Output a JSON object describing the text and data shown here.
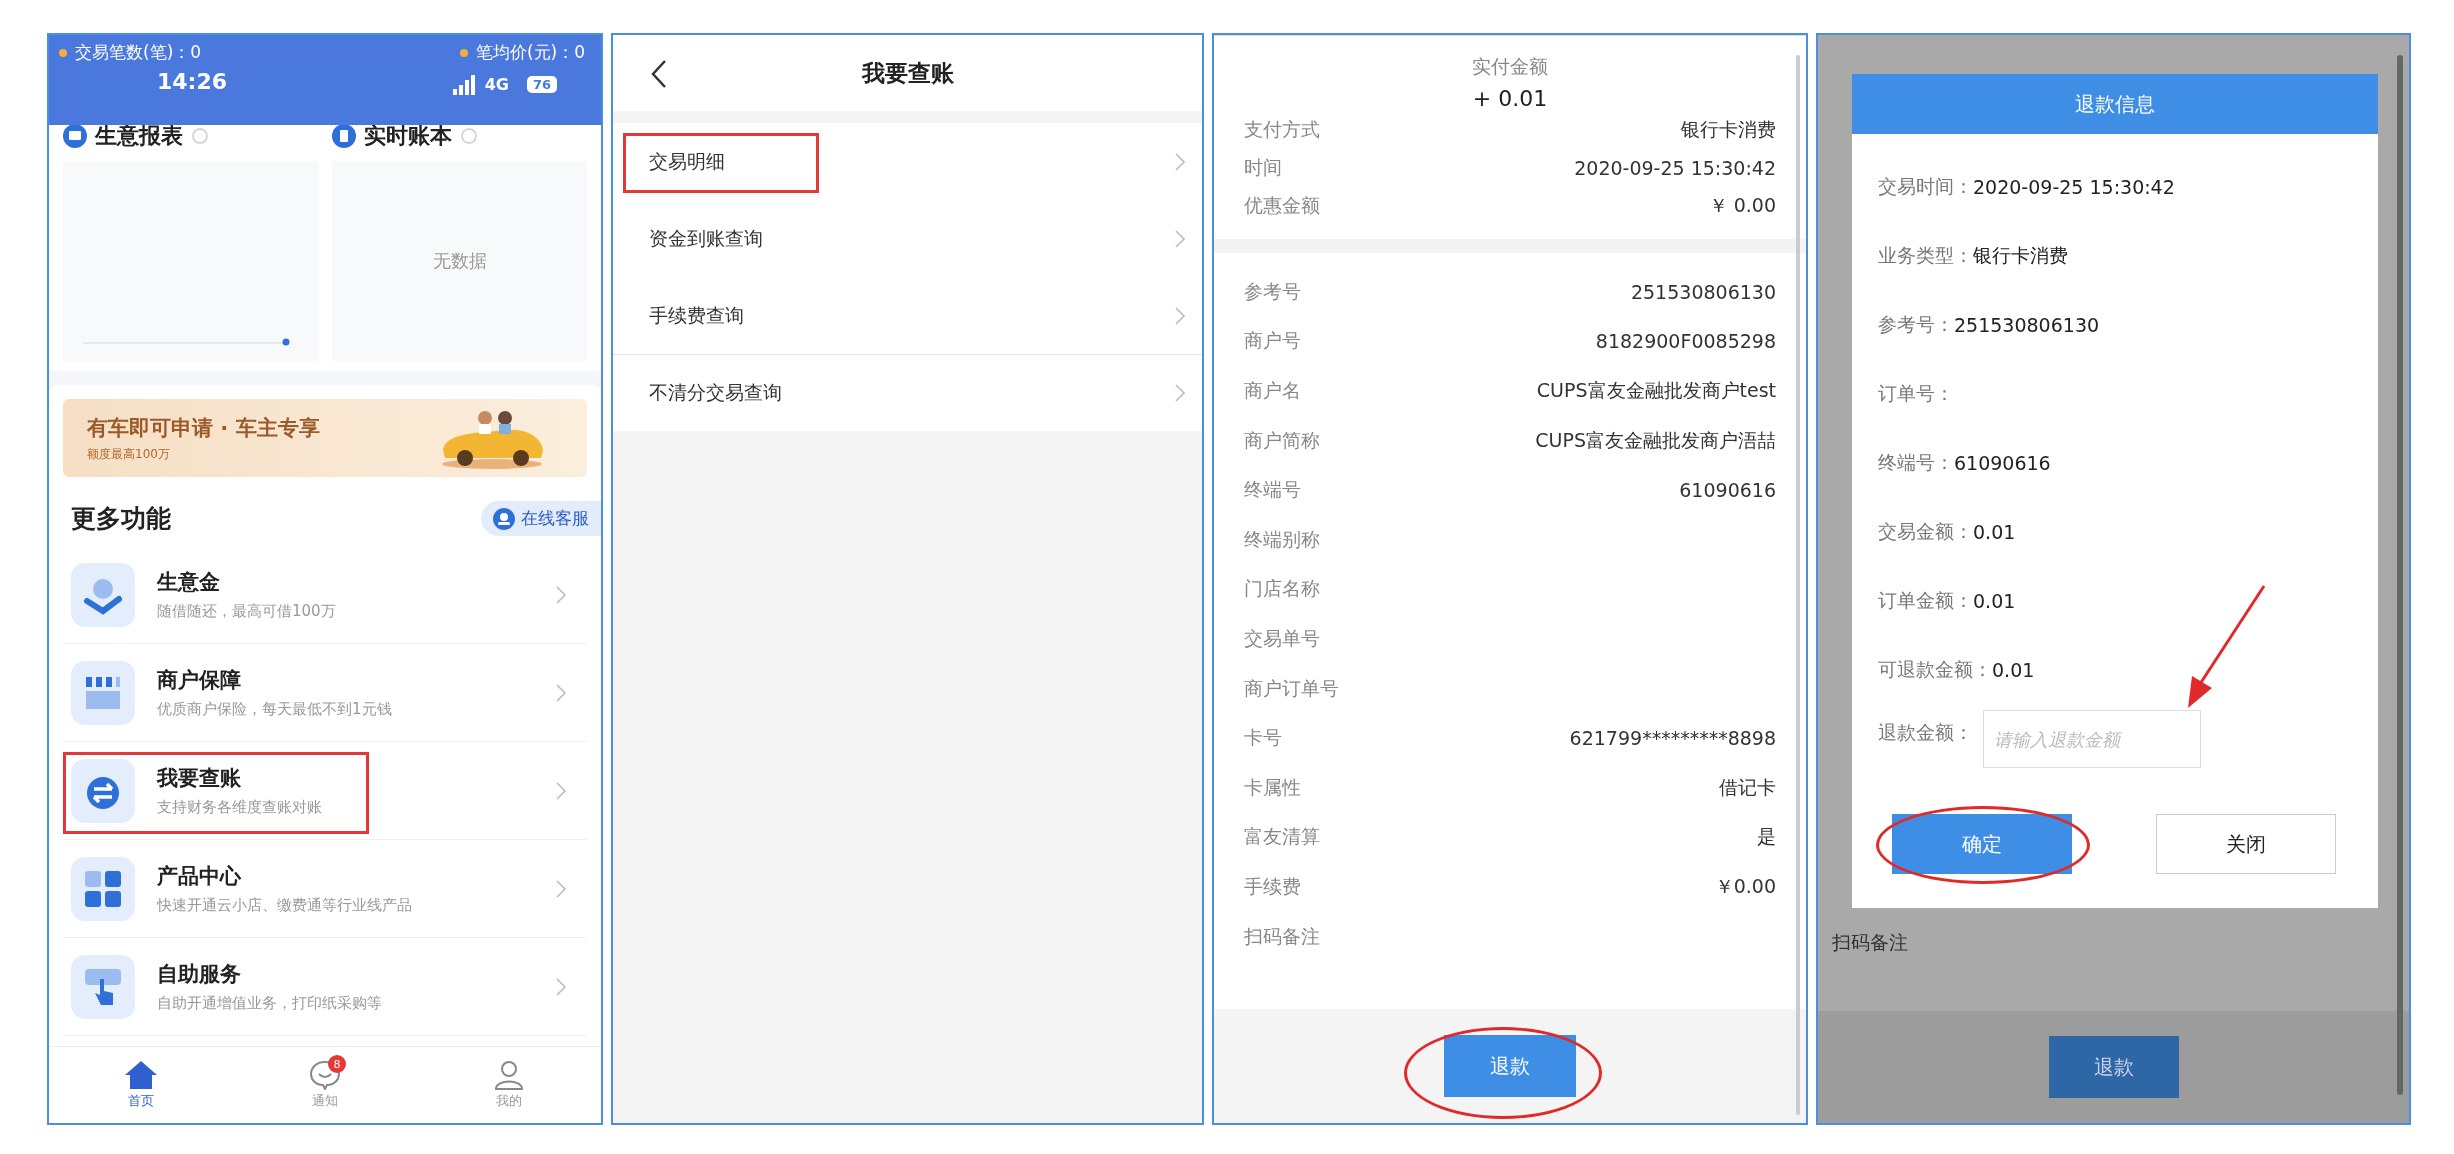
{
  "home": {
    "status_bar": {
      "stat_left": "交易笔数(笔)：0",
      "time": "14:26",
      "stat_right": "笔均价(元)：0",
      "network": "4G",
      "battery": "76"
    },
    "cards": [
      {
        "title": "生意报表",
        "kind": "chart"
      },
      {
        "title": "实时账本",
        "kind": "empty",
        "empty_text": "无数据"
      }
    ],
    "banner": {
      "title": "有车即可申请 · 车主专享",
      "subtitle": "额度最高100万"
    },
    "section_title": "更多功能",
    "service_button": "在线客服",
    "items": [
      {
        "title": "生意金",
        "subtitle": "随借随还，最高可借100万",
        "kind": "loan",
        "highlighted": false
      },
      {
        "title": "商户保障",
        "subtitle": "优质商户保险，每天最低不到1元钱",
        "kind": "store",
        "highlighted": false
      },
      {
        "title": "我要查账",
        "subtitle": "支持财务各维度查账对账",
        "kind": "exchange",
        "highlighted": true
      },
      {
        "title": "产品中心",
        "subtitle": "快速开通云小店、缴费通等行业线产品",
        "kind": "grid",
        "highlighted": false
      },
      {
        "title": "自助服务",
        "subtitle": "自助开通增值业务，打印纸采购等",
        "kind": "touch",
        "highlighted": false
      }
    ],
    "nav": [
      {
        "label": "首页",
        "kind": "home",
        "selected": true
      },
      {
        "label": "通知",
        "kind": "message",
        "selected": false,
        "badge": "8"
      },
      {
        "label": "我的",
        "kind": "profile",
        "selected": false
      }
    ]
  },
  "ledger": {
    "title": "我要查账",
    "items": [
      {
        "label": "交易明细",
        "highlighted": true
      },
      {
        "label": "资金到账查询",
        "highlighted": false
      },
      {
        "label": "手续费查询",
        "highlighted": false
      },
      {
        "label": "不清分交易查询",
        "highlighted": false
      }
    ]
  },
  "detail": {
    "amount_label": "实付金额",
    "amount": "+ 0.01",
    "summary": [
      {
        "label": "支付方式",
        "value": "银行卡消费"
      },
      {
        "label": "时间",
        "value": "2020-09-25 15:30:42"
      },
      {
        "label": "优惠金额",
        "value": "￥ 0.00"
      }
    ],
    "fields": [
      {
        "label": "参考号",
        "value": "251530806130"
      },
      {
        "label": "商户号",
        "value": "8182900F0085298"
      },
      {
        "label": "商户名",
        "value": "CUPS富友金融批发商户test"
      },
      {
        "label": "商户简称",
        "value": "CUPS富友金融批发商户浯喆"
      },
      {
        "label": "终端号",
        "value": "61090616"
      },
      {
        "label": "终端别称"
      },
      {
        "label": "门店名称"
      },
      {
        "label": "交易单号"
      },
      {
        "label": "商户订单号"
      },
      {
        "label": "卡号",
        "value": "621799*********8898"
      },
      {
        "label": "卡属性",
        "value": "借记卡"
      },
      {
        "label": "富友清算",
        "value": "是"
      },
      {
        "label": "手续费",
        "value": "￥0.00"
      },
      {
        "label": "扫码备注"
      }
    ],
    "refund_button": {
      "label": "退款",
      "circled": true
    }
  },
  "refund_screen": {
    "behind": {
      "remark_label": "扫码备注",
      "refund_button": "退款"
    },
    "dialog": {
      "title": "退款信息",
      "rows": [
        {
          "label": "交易时间：",
          "value": "2020-09-25 15:30:42"
        },
        {
          "label": "业务类型：",
          "value": "银行卡消费"
        },
        {
          "label": "参考号：",
          "value": "251530806130"
        },
        {
          "label": "订单号："
        },
        {
          "label": "终端号：",
          "value": "61090616"
        },
        {
          "label": "交易金额：",
          "value": "0.01"
        },
        {
          "label": "订单金额：",
          "value": "0.01"
        },
        {
          "label": "可退款金额：",
          "value": "0.01"
        }
      ],
      "amount_label": "退款金额：",
      "amount_field": {
        "placeholder": "请输入退款金额",
        "pointed": true
      },
      "buttons": [
        {
          "label": "确定",
          "kind": "primary",
          "circled": true
        },
        {
          "label": "关闭",
          "kind": "secondary",
          "circled": false
        }
      ]
    }
  }
}
